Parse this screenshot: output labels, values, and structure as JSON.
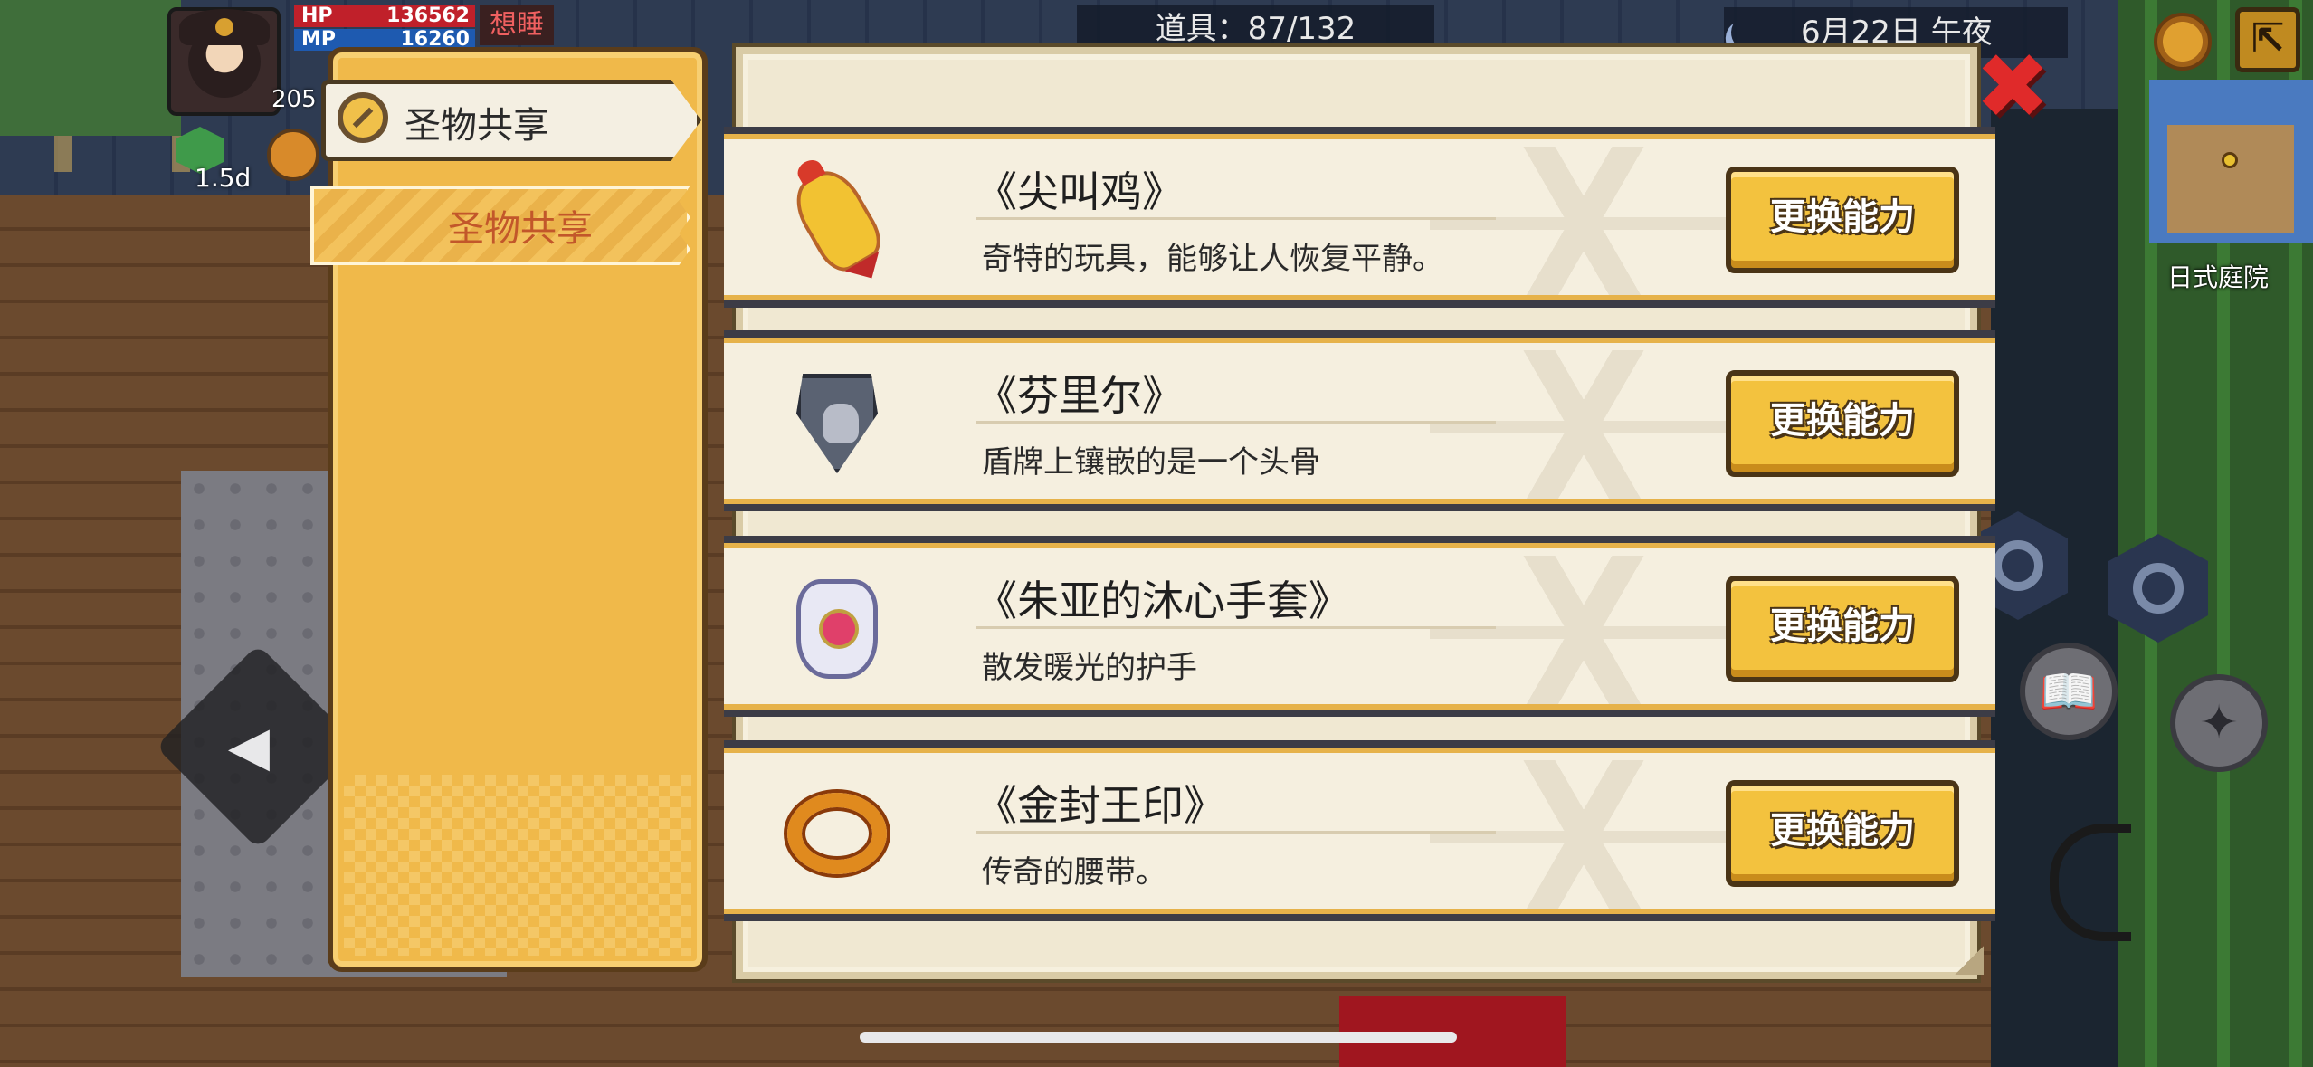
{
  "hud": {
    "hp_label": "HP",
    "hp_value": "136562",
    "mp_label": "MP",
    "mp_value": "16260",
    "level": "205",
    "status_badge": "想睡",
    "buff_time": "1.5d",
    "items_counter": "道具：87/132",
    "date": "6月22日 午夜",
    "map_location": "日式庭院"
  },
  "tabs": {
    "header_label": "圣物共享",
    "items": [
      {
        "label": "圣物共享",
        "selected": true
      }
    ]
  },
  "relics": [
    {
      "name": "《尖叫鸡》",
      "description": "奇特的玩具，能够让人恢复平静。",
      "icon": "rubber-chicken-icon",
      "button": "更换能力"
    },
    {
      "name": "《芬里尔》",
      "description": "盾牌上镶嵌的是一个头骨",
      "icon": "wolf-shield-icon",
      "button": "更换能力"
    },
    {
      "name": "《朱亚的沐心手套》",
      "description": "散发暖光的护手",
      "icon": "gauntlet-icon",
      "button": "更换能力"
    },
    {
      "name": "《金封王印》",
      "description": "传奇的腰带。",
      "icon": "golden-belt-icon",
      "button": "更换能力"
    }
  ],
  "colors": {
    "panel_gold": "#f0b94a",
    "button_gold": "#f3c23e",
    "close_red": "#e02a2a",
    "hp_red": "#c0202a",
    "mp_blue": "#1e5ab0"
  }
}
